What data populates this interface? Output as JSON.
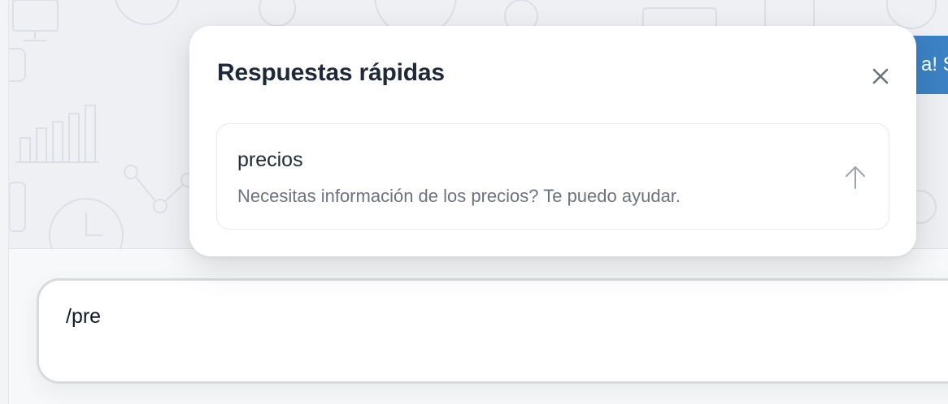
{
  "background_message": {
    "text": "a! S"
  },
  "quick_replies": {
    "title": "Respuestas rápidas",
    "close_icon": "close-icon",
    "items": [
      {
        "shortcut": "precios",
        "text": "Necesitas información de los precios? Te puedo ayudar.",
        "icon": "arrow-up-icon"
      }
    ]
  },
  "composer": {
    "value": "/pre"
  },
  "colors": {
    "bubble": "#3b82c4",
    "title": "#1f2937",
    "muted": "#6b7280"
  }
}
